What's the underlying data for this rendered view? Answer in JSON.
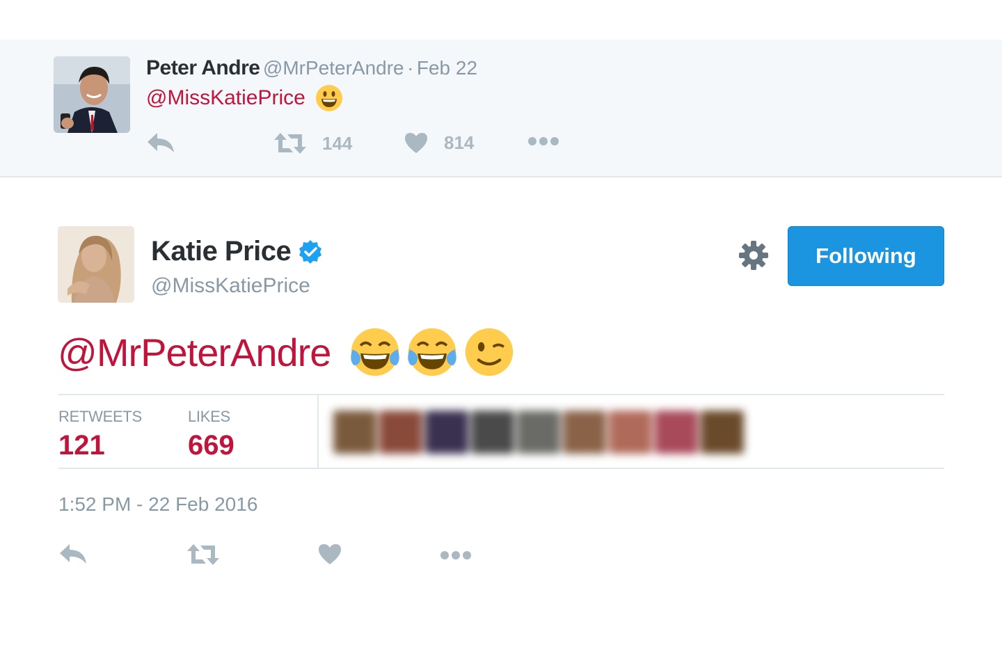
{
  "parent_tweet": {
    "author_name": "Peter Andre",
    "author_handle": "@MrPeterAndre",
    "separator": "·",
    "date": "Feb 22",
    "mention": "@MissKatiePrice",
    "emoji": "grinning-face",
    "retweet_count": "144",
    "like_count": "814"
  },
  "main_tweet": {
    "author_name": "Katie Price",
    "verified": true,
    "author_handle": "@MissKatiePrice",
    "follow_button_label": "Following",
    "mention": "@MrPeterAndre",
    "emojis": [
      "face-with-tears-of-joy",
      "face-with-tears-of-joy",
      "winking-face"
    ],
    "stats": {
      "retweets_label": "RETWEETS",
      "retweets_value": "121",
      "likes_label": "LIKES",
      "likes_value": "669"
    },
    "timestamp": "1:52 PM - 22 Feb 2016"
  },
  "colors": {
    "mention": "#c0143c",
    "button": "#1b95e0",
    "muted": "#8899a6",
    "icon": "#aab8c2",
    "verified": "#1da1f2"
  }
}
